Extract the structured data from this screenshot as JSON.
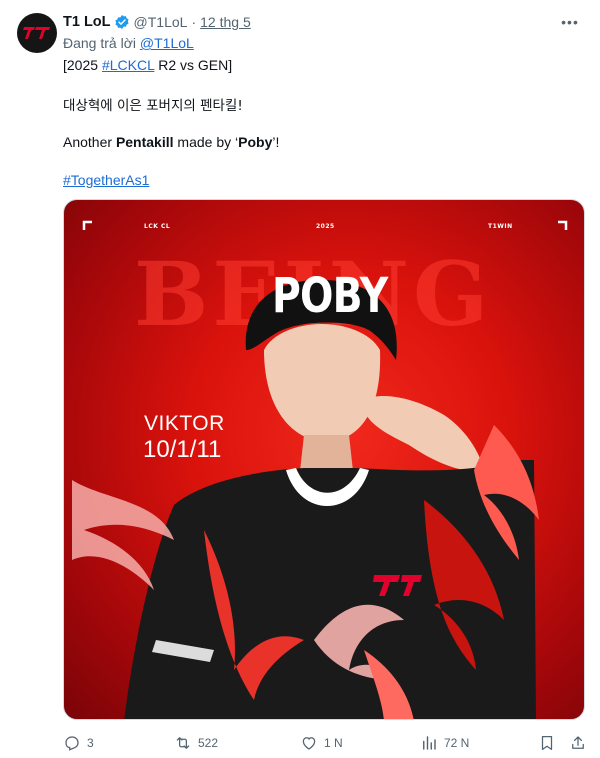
{
  "tweet": {
    "display_name": "T1 LoL",
    "handle": "@T1LoL",
    "separator": "·",
    "time": "12 thg 5",
    "more_icon": "more-icon",
    "reply_prefix": "Đang trả lời",
    "reply_handle": "@T1LoL",
    "line1_a": "[2025 ",
    "line1_hashtag": "#LCKCL",
    "line1_b": " R2 vs GEN]",
    "korean": "대상혁에 이은 포버지의 펜타킬!",
    "line3_a": "Another ",
    "line3_bold1": "Pentakill",
    "line3_b": " made by ‘",
    "line3_bold2": "Poby",
    "line3_c": "’!",
    "hashtag": "#TogetherAs1"
  },
  "media": {
    "league_label": "LCK CL",
    "year_label": "2025",
    "team_label": "T1WIN",
    "bg_title": "BEING",
    "player_name": "POBY",
    "champion": "VIKTOR",
    "kda": "10/1/11"
  },
  "actions": {
    "replies": "3",
    "retweets": "522",
    "likes": "1 N",
    "views": "72 N"
  },
  "colors": {
    "link": "#1d6cd3",
    "secondary": "#536471",
    "verified": "#1d9bf0",
    "media_red": "#d9120c"
  }
}
